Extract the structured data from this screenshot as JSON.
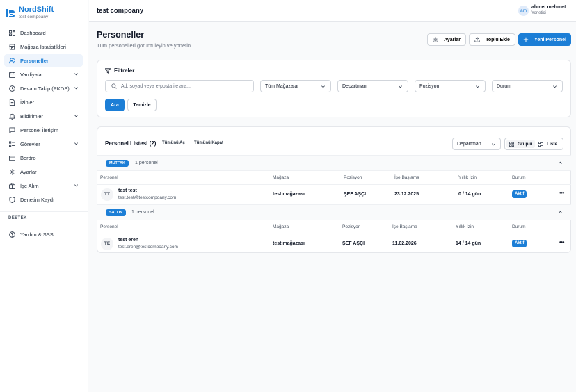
{
  "brand": {
    "name": "NordShift",
    "company": "test compoany"
  },
  "sidebar": {
    "items": [
      {
        "label": "Dashboard",
        "icon": "dashboard-icon"
      },
      {
        "label": "Mağaza İstatistikleri",
        "icon": "store-icon"
      },
      {
        "label": "Personeller",
        "icon": "users-icon",
        "active": true
      },
      {
        "label": "Vardiyalar",
        "icon": "calendar-icon",
        "expandable": true
      },
      {
        "label": "Devam Takip (PKDS)",
        "icon": "clock-icon",
        "expandable": true
      },
      {
        "label": "İzinler",
        "icon": "leave-icon"
      },
      {
        "label": "Bildirimler",
        "icon": "bell-icon",
        "expandable": true
      },
      {
        "label": "Personel İletişim",
        "icon": "message-icon"
      },
      {
        "label": "Görevler",
        "icon": "tasks-icon",
        "expandable": true
      },
      {
        "label": "Bordro",
        "icon": "payroll-icon"
      },
      {
        "label": "Ayarlar",
        "icon": "gear-icon"
      },
      {
        "label": "İşe Alım",
        "icon": "briefcase-icon",
        "expandable": true
      },
      {
        "label": "Denetim Kaydı",
        "icon": "shield-icon"
      }
    ],
    "section_title": "DESTEK",
    "support_items": [
      {
        "label": "Yardım & SSS",
        "icon": "help-icon"
      }
    ]
  },
  "topbar": {
    "company_title": "test compoany",
    "user": {
      "initials": "am",
      "name": "ahmet mehmet",
      "role": "Yonetici"
    }
  },
  "page": {
    "title": "Personeller",
    "subtitle": "Tüm personelleri görüntüleyin ve yönetin",
    "actions": {
      "settings": "Ayarlar",
      "bulk_add": "Toplu Ekle",
      "new_staff": "Yeni Personel"
    }
  },
  "filters": {
    "title": "Filtreler",
    "search_placeholder": "Ad, soyad veya e-posta ile ara...",
    "store": "Tüm Mağazalar",
    "department": "Departman",
    "position": "Pozisyon",
    "status": "Durum",
    "search_button": "Ara",
    "clear_button": "Temizle"
  },
  "list": {
    "title": "Personel Listesi (2)",
    "expand_all": "Tümünü Aç",
    "collapse_all": "Tümünü Kapat",
    "group_by": "Departman",
    "view_grouped": "Gruplu",
    "view_list": "Liste",
    "columns": [
      "Personel",
      "Mağaza",
      "Pozisyon",
      "İşe Başlama",
      "Yıllık İzin",
      "Durum"
    ],
    "groups": [
      {
        "name": "MUTFAK",
        "count": "1 personel",
        "rows": [
          {
            "initials": "TT",
            "name": "test test",
            "email": "test.test@testcompoany.com",
            "store": "test mağazası",
            "position": "ŞEF AŞÇI",
            "start_date": "23.12.2025",
            "leave": "0 / 14 gün",
            "status": "Aktif"
          }
        ]
      },
      {
        "name": "SALON",
        "count": "1 personel",
        "rows": [
          {
            "initials": "TE",
            "name": "test eren",
            "email": "test.eren@testcompoany.com",
            "store": "test mağazası",
            "position": "ŞEF AŞÇI",
            "start_date": "11.02.2026",
            "leave": "14 / 14 gün",
            "status": "Aktif"
          }
        ]
      }
    ]
  },
  "colors": {
    "accent": "#1c7ed6",
    "active_nav_bg": "#eef4fc",
    "border": "#e5e7eb"
  }
}
